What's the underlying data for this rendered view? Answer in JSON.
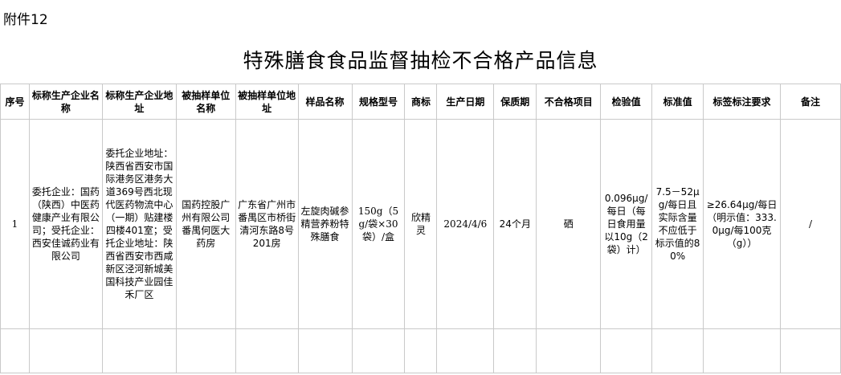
{
  "attachment_label": "附件12",
  "title": "特殊膳食食品监督抽检不合格产品信息",
  "table": {
    "headers": [
      "序号",
      "标称生产企业名称",
      "标称生产企业地址",
      "被抽样单位名称",
      "被抽样单位地址",
      "样品名称",
      "规格型号",
      "商标",
      "生产日期",
      "保质期",
      "不合格项目",
      "检验值",
      "标准值",
      "标签标注要求",
      "备注"
    ],
    "rows": [
      [
        "1",
        "委托企业：国药（陕西）中医药健康产业有限公司；受托企业：西安佳诚药业有限公司",
        "委托企业地址：陕西省西安市国际港务区港务大道369号西北现代医药物流中心（一期）贴建楼四楼401室；受托企业地址：陕西省西安市西咸新区泾河新城美国科技产业园佳禾厂区",
        "国药控股广州有限公司番禺何医大药房",
        "广东省广州市番禺区市桥街清河东路8号201房",
        "左旋肉碱参精营养粉特殊膳食",
        "150g（5g/袋×30袋）/盒",
        "欣精灵",
        "2024/4/6",
        "24个月",
        "硒",
        "0.096μg/每日（每日食用量以10g（2袋）计）",
        "7.5－52μg/每日且实际含量不应低于标示值的80%",
        "≥26.64μg/每日（明示值：333.0μg/每100克（g））",
        "/"
      ]
    ]
  }
}
